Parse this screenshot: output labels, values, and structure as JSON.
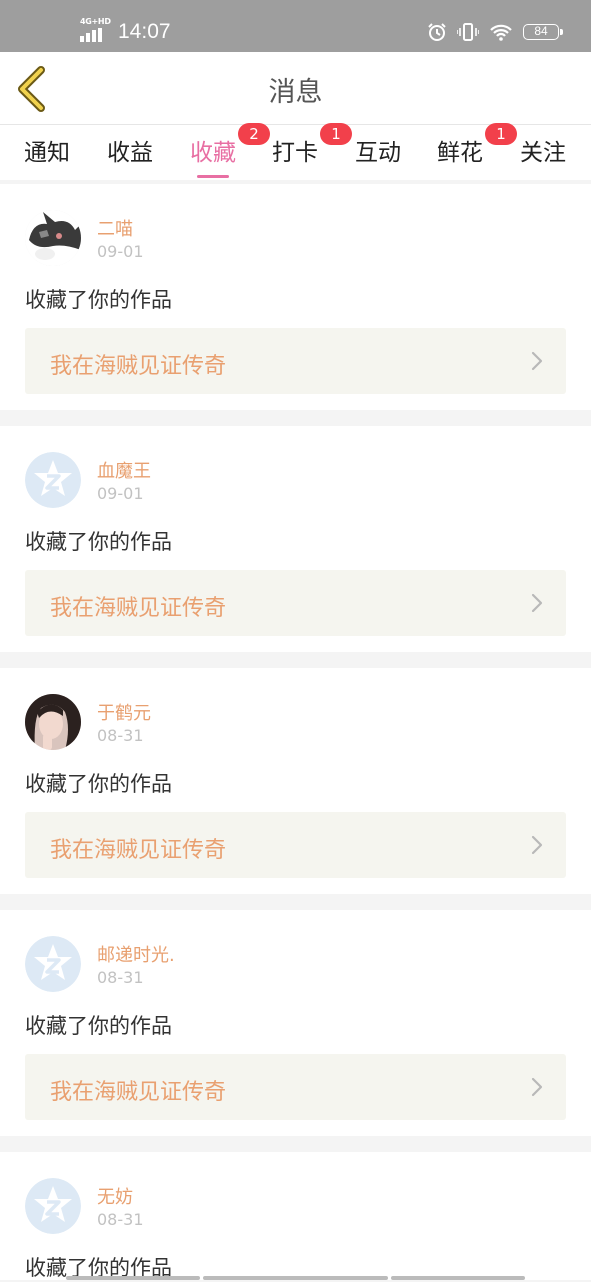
{
  "status_bar": {
    "network": "4G+HD",
    "time": "14:07",
    "battery": "84",
    "icons": [
      "alarm-icon",
      "vibrate-icon",
      "wifi-icon",
      "battery-icon"
    ]
  },
  "header": {
    "title": "消息",
    "back_icon": "chevron-left-icon"
  },
  "tabs": [
    {
      "label": "通知",
      "badge": ""
    },
    {
      "label": "收益",
      "badge": ""
    },
    {
      "label": "收藏",
      "badge": "2",
      "active": true
    },
    {
      "label": "打卡",
      "badge": "1"
    },
    {
      "label": "互动",
      "badge": ""
    },
    {
      "label": "鲜花",
      "badge": "1"
    },
    {
      "label": "关注",
      "badge": ""
    }
  ],
  "messages": [
    {
      "user": "二喵",
      "date": "09-01",
      "action": "收藏了你的作品",
      "work": "我在海贼见证传奇",
      "avatar": "cat-avatar"
    },
    {
      "user": "血魔王",
      "date": "09-01",
      "action": "收藏了你的作品",
      "work": "我在海贼见证传奇",
      "avatar": "default-avatar"
    },
    {
      "user": "于鹤元",
      "date": "08-31",
      "action": "收藏了你的作品",
      "work": "我在海贼见证传奇",
      "avatar": "photo-avatar"
    },
    {
      "user": "邮递时光.",
      "date": "08-31",
      "action": "收藏了你的作品",
      "work": "我在海贼见证传奇",
      "avatar": "default-avatar"
    },
    {
      "user": "无妨",
      "date": "08-31",
      "action": "收藏了你的作品",
      "work": "",
      "avatar": "default-avatar"
    }
  ],
  "colors": {
    "accent": "#e86fa3",
    "badge": "#f2404b",
    "username": "#e8a070",
    "work_title": "#e9a070",
    "status_bar": "#9e9e9e"
  }
}
